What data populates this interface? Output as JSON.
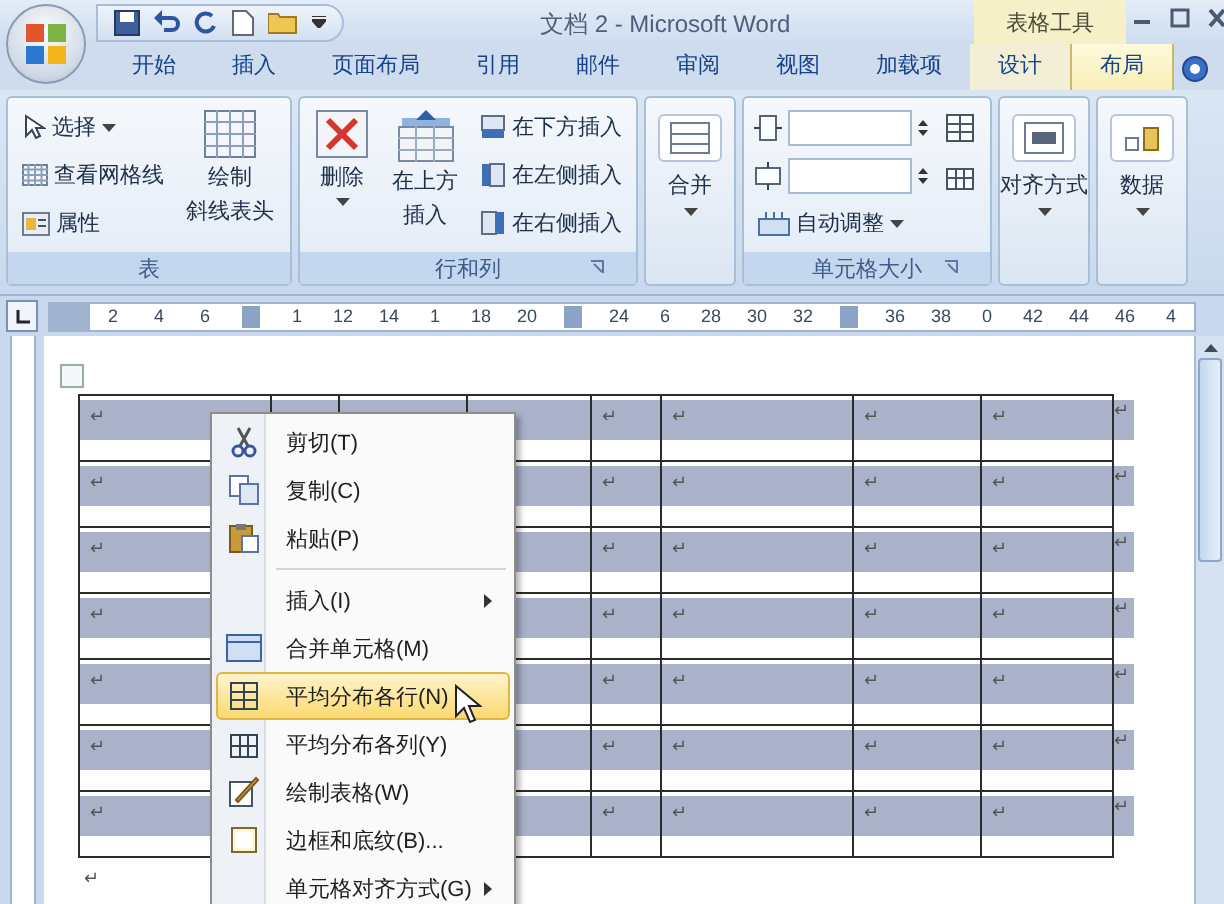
{
  "title_bar": {
    "title": "文档 2 - Microsoft Word",
    "context_group": "表格工具"
  },
  "tabs": [
    {
      "label": "开始",
      "selected": false,
      "contextual": false
    },
    {
      "label": "插入",
      "selected": false,
      "contextual": false
    },
    {
      "label": "页面布局",
      "selected": false,
      "contextual": false
    },
    {
      "label": "引用",
      "selected": false,
      "contextual": false
    },
    {
      "label": "邮件",
      "selected": false,
      "contextual": false
    },
    {
      "label": "审阅",
      "selected": false,
      "contextual": false
    },
    {
      "label": "视图",
      "selected": false,
      "contextual": false
    },
    {
      "label": "加载项",
      "selected": false,
      "contextual": false
    },
    {
      "label": "设计",
      "selected": false,
      "contextual": true
    },
    {
      "label": "布局",
      "selected": true,
      "contextual": true
    }
  ],
  "ribbon": {
    "groups": [
      {
        "kind": "group",
        "title": "表",
        "launcher": false,
        "columns": [
          {
            "kind": "stack",
            "items": [
              {
                "kind": "button",
                "label": "选择",
                "dropdown": true
              },
              {
                "kind": "button",
                "label": "查看网格线",
                "dropdown": false
              },
              {
                "kind": "button",
                "label": "属性",
                "dropdown": false
              }
            ]
          },
          {
            "kind": "large",
            "lines": [
              "绘制",
              "斜线表头"
            ],
            "dropdown": false
          }
        ]
      },
      {
        "kind": "group",
        "title": "行和列",
        "launcher": true,
        "columns": [
          {
            "kind": "large",
            "lines": [
              "删除"
            ],
            "dropdown": true
          },
          {
            "kind": "large",
            "lines": [
              "在上方",
              "插入"
            ],
            "dropdown": false
          },
          {
            "kind": "stack",
            "items": [
              {
                "kind": "button",
                "label": "在下方插入",
                "dropdown": false
              },
              {
                "kind": "button",
                "label": "在左侧插入",
                "dropdown": false
              },
              {
                "kind": "button",
                "label": "在右侧插入",
                "dropdown": false
              }
            ]
          }
        ]
      },
      {
        "kind": "collapsed",
        "label": "合并"
      },
      {
        "kind": "group",
        "title": "单元格大小",
        "launcher": true,
        "columns": [
          {
            "kind": "stack",
            "items": [
              {
                "kind": "spinner"
              },
              {
                "kind": "spinner"
              },
              {
                "kind": "button",
                "label": "自动调整",
                "dropdown": true
              }
            ]
          },
          {
            "kind": "stack",
            "items": [
              {
                "kind": "icon_button"
              },
              {
                "kind": "icon_button"
              }
            ]
          }
        ]
      },
      {
        "kind": "collapsed",
        "label": "对齐方式"
      },
      {
        "kind": "collapsed",
        "label": "数据"
      }
    ]
  },
  "ruler": {
    "slots": [
      {
        "kind": "number",
        "text": "2"
      },
      {
        "kind": "number",
        "text": "4"
      },
      {
        "kind": "number",
        "text": "6"
      },
      {
        "kind": "marker"
      },
      {
        "kind": "number",
        "text": "1"
      },
      {
        "kind": "number",
        "text": "12"
      },
      {
        "kind": "number",
        "text": "14"
      },
      {
        "kind": "number",
        "text": "1"
      },
      {
        "kind": "number",
        "text": "18"
      },
      {
        "kind": "number",
        "text": "20"
      },
      {
        "kind": "marker"
      },
      {
        "kind": "number",
        "text": "24"
      },
      {
        "kind": "number",
        "text": "6"
      },
      {
        "kind": "number",
        "text": "28"
      },
      {
        "kind": "number",
        "text": "30"
      },
      {
        "kind": "number",
        "text": "32"
      },
      {
        "kind": "marker"
      },
      {
        "kind": "number",
        "text": "36"
      },
      {
        "kind": "number",
        "text": "38"
      },
      {
        "kind": "number",
        "text": "0"
      },
      {
        "kind": "number",
        "text": "42"
      },
      {
        "kind": "number",
        "text": "44"
      },
      {
        "kind": "number",
        "text": "46"
      },
      {
        "kind": "number",
        "text": "4"
      }
    ]
  },
  "table": {
    "rows": [
      {
        "selected": true,
        "cells": [
          "↵",
          "↵",
          "↵",
          "↵",
          "↵"
        ],
        "end_mark": "↵"
      },
      {
        "selected": true,
        "cells": [
          "↵",
          "↵",
          "↵",
          "↵",
          "↵"
        ],
        "end_mark": "↵"
      },
      {
        "selected": true,
        "cells": [
          "↵",
          "↵",
          "↵",
          "↵",
          "↵"
        ],
        "end_mark": "↵"
      },
      {
        "selected": true,
        "cells": [
          "↵",
          "↵",
          "↵",
          "↵",
          "↵"
        ],
        "end_mark": "↵"
      },
      {
        "selected": true,
        "cells": [
          "↵",
          "↵",
          "↵",
          "↵",
          "↵"
        ],
        "end_mark": "↵"
      },
      {
        "selected": true,
        "cells": [
          "↵",
          "↵",
          "↵",
          "↵",
          "↵"
        ],
        "end_mark": "↵"
      },
      {
        "selected": true,
        "cells": [
          "↵",
          "↵",
          "↵",
          "↵",
          "↵"
        ],
        "end_mark": "↵"
      }
    ]
  },
  "paragraph_mark": "↵",
  "context_menu": {
    "items": [
      {
        "kind": "item",
        "label": "剪切(T)",
        "has_icon": true,
        "submenu": false,
        "selected": false
      },
      {
        "kind": "item",
        "label": "复制(C)",
        "has_icon": true,
        "submenu": false,
        "selected": false
      },
      {
        "kind": "item",
        "label": "粘贴(P)",
        "has_icon": true,
        "submenu": false,
        "selected": false
      },
      {
        "kind": "separator"
      },
      {
        "kind": "item",
        "label": "插入(I)",
        "has_icon": false,
        "submenu": true,
        "selected": false
      },
      {
        "kind": "item",
        "label": "合并单元格(M)",
        "has_icon": true,
        "submenu": false,
        "selected": false
      },
      {
        "kind": "item",
        "label": "平均分布各行(N)",
        "has_icon": true,
        "submenu": false,
        "selected": true
      },
      {
        "kind": "item",
        "label": "平均分布各列(Y)",
        "has_icon": true,
        "submenu": false,
        "selected": false
      },
      {
        "kind": "item",
        "label": "绘制表格(W)",
        "has_icon": true,
        "submenu": false,
        "selected": false
      },
      {
        "kind": "item",
        "label": "边框和底纹(B)...",
        "has_icon": true,
        "submenu": false,
        "selected": false
      },
      {
        "kind": "item",
        "label": "单元格对齐方式(G)",
        "has_icon": false,
        "submenu": true,
        "selected": false
      }
    ]
  }
}
